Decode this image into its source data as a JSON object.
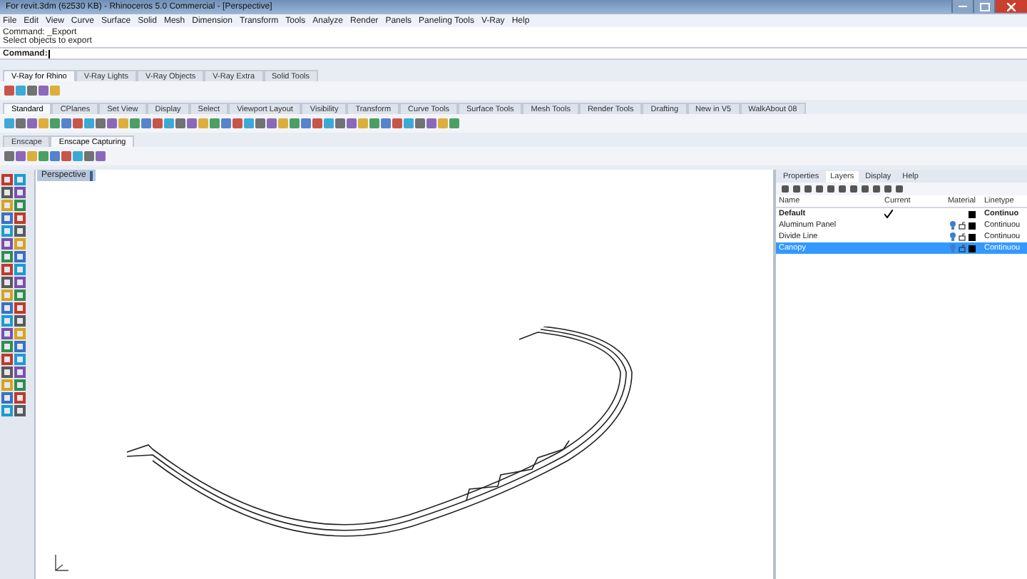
{
  "window": {
    "title": "For revit.3dm (62530 KB) - Rhinoceros 5.0 Commercial - [Perspective]"
  },
  "menu": [
    "File",
    "Edit",
    "View",
    "Curve",
    "Surface",
    "Solid",
    "Mesh",
    "Dimension",
    "Transform",
    "Tools",
    "Analyze",
    "Render",
    "Panels",
    "Paneling Tools",
    "V-Ray",
    "Help"
  ],
  "command_history": [
    "Command: _Export",
    "Select objects to export"
  ],
  "command_prompt": {
    "label": "Command:"
  },
  "toolbar_groups": [
    {
      "tabs": [
        {
          "label": "V-Ray for Rhino",
          "selected": true
        },
        {
          "label": "V-Ray Lights",
          "selected": false
        },
        {
          "label": "V-Ray Objects",
          "selected": false
        },
        {
          "label": "V-Ray Extra",
          "selected": false
        },
        {
          "label": "Solid Tools",
          "selected": false
        }
      ]
    },
    {
      "tabs": [
        {
          "label": "Standard",
          "selected": true
        },
        {
          "label": "CPlanes",
          "selected": false
        },
        {
          "label": "Set View",
          "selected": false
        },
        {
          "label": "Display",
          "selected": false
        },
        {
          "label": "Select",
          "selected": false
        },
        {
          "label": "Viewport Layout",
          "selected": false
        },
        {
          "label": "Visibility",
          "selected": false
        },
        {
          "label": "Transform",
          "selected": false
        },
        {
          "label": "Curve Tools",
          "selected": false
        },
        {
          "label": "Surface Tools",
          "selected": false
        },
        {
          "label": "Mesh Tools",
          "selected": false
        },
        {
          "label": "Render Tools",
          "selected": false
        },
        {
          "label": "Drafting",
          "selected": false
        },
        {
          "label": "New in V5",
          "selected": false
        },
        {
          "label": "WalkAbout 08",
          "selected": false
        }
      ]
    },
    {
      "tabs": [
        {
          "label": "Enscape",
          "selected": false
        },
        {
          "label": "Enscape Capturing",
          "selected": true
        }
      ]
    }
  ],
  "viewport": {
    "tab": "Perspective"
  },
  "panel": {
    "tabs": [
      {
        "label": "Properties",
        "selected": false
      },
      {
        "label": "Layers",
        "selected": true
      },
      {
        "label": "Display",
        "selected": false
      },
      {
        "label": "Help",
        "selected": false
      }
    ],
    "columns": [
      "Name",
      "Current",
      "Material",
      "Linetype"
    ],
    "layers": [
      {
        "name": "Default",
        "current": true,
        "selected": false,
        "color": "#000000",
        "linetype": "Continuo"
      },
      {
        "name": "Aluminum Panel",
        "current": false,
        "selected": false,
        "color": "#000000",
        "linetype": "Continuou"
      },
      {
        "name": "Divide Line",
        "current": false,
        "selected": false,
        "color": "#000000",
        "linetype": "Continuou"
      },
      {
        "name": "Canopy",
        "current": false,
        "selected": true,
        "color": "#000000",
        "linetype": "Continuou"
      }
    ]
  }
}
